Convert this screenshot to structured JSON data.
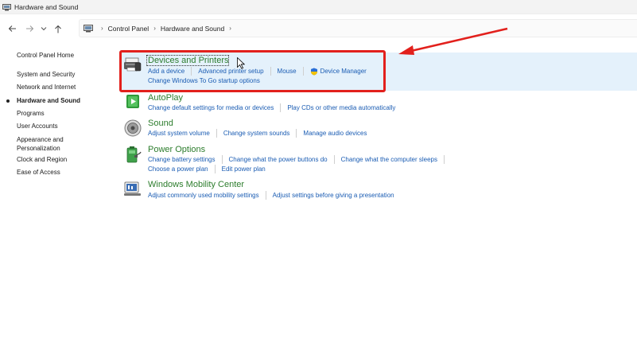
{
  "window": {
    "title": "Hardware and Sound"
  },
  "nav": {
    "breadcrumb": [
      "Control Panel",
      "Hardware and Sound"
    ]
  },
  "sidebar": {
    "items": [
      {
        "label": "Control Panel Home"
      },
      {
        "label": "System and Security"
      },
      {
        "label": "Network and Internet"
      },
      {
        "label": "Hardware and Sound",
        "active": true
      },
      {
        "label": "Programs"
      },
      {
        "label": "User Accounts"
      },
      {
        "label": "Appearance and",
        "label2": "Personalization"
      },
      {
        "label": "Clock and Region"
      },
      {
        "label": "Ease of Access"
      }
    ]
  },
  "categories": [
    {
      "title": "Devices and Printers",
      "icon": "printer-icon",
      "rows": [
        [
          "Add a device",
          "Advanced printer setup",
          "Mouse",
          "Device Manager"
        ],
        [
          "Change Windows To Go startup options"
        ]
      ]
    },
    {
      "title": "AutoPlay",
      "icon": "autoplay-icon",
      "rows": [
        [
          "Change default settings for media or devices",
          "Play CDs or other media automatically"
        ]
      ]
    },
    {
      "title": "Sound",
      "icon": "speaker-icon",
      "rows": [
        [
          "Adjust system volume",
          "Change system sounds",
          "Manage audio devices"
        ]
      ]
    },
    {
      "title": "Power Options",
      "icon": "battery-icon",
      "rows": [
        [
          "Change battery settings",
          "Change what the power buttons do",
          "Change what the computer sleeps"
        ],
        [
          "Choose a power plan",
          "Edit power plan"
        ]
      ]
    },
    {
      "title": "Windows Mobility Center",
      "icon": "mobility-center-icon",
      "rows": [
        [
          "Adjust commonly used mobility settings",
          "Adjust settings before giving a presentation"
        ]
      ]
    }
  ],
  "colors": {
    "link": "#1a5cb3",
    "category_title": "#2d7d2d",
    "highlight": "#e4f1fb",
    "annotation": "#e2201c"
  }
}
